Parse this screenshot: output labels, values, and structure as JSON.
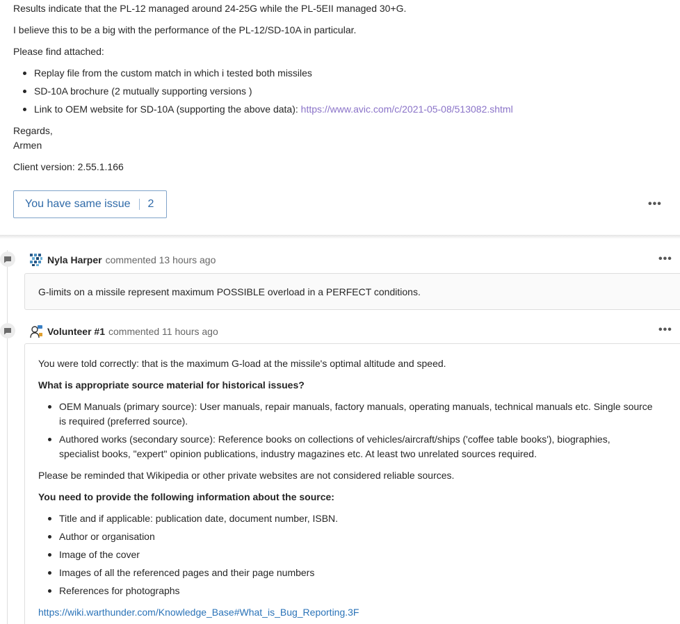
{
  "issue": {
    "line1": "Results indicate that the PL-12 managed around 24-25G while the PL-5EII managed 30+G.",
    "line2": "I believe this to be a big with the performance of the PL-12/SD-10A in particular.",
    "attached_intro": "Please find attached:",
    "attachments": [
      {
        "text": "Replay file from the custom match in which i tested both missiles"
      },
      {
        "text": "SD-10A brochure (2 mutually supporting versions )"
      },
      {
        "text": "Link to OEM website for SD-10A (supporting the above data): ",
        "link": "https://www.avic.com/c/2021-05-08/513082.shtml"
      }
    ],
    "regards": "Regards,",
    "signature": "Armen",
    "client_version": "Client version: 2.55.1.166",
    "same_issue_label": "You have same issue",
    "same_issue_count": "2",
    "more": "•••"
  },
  "comments": [
    {
      "author": "Nyla Harper",
      "meta": "commented 13 hours ago",
      "avatar_icon": "pixel-avatar-icon",
      "more": "•••",
      "text": "G-limits on a missile represent maximum POSSIBLE overload in a PERFECT conditions."
    },
    {
      "author": "Volunteer #1",
      "meta": "commented 11 hours ago",
      "avatar_icon": "volunteer-avatar-icon",
      "more": "•••",
      "intro": "You were told correctly: that is the maximum G-load at the missile's optimal altitude and speed.",
      "heading1": "What is appropriate source material for historical issues?",
      "sources": [
        {
          "line1": "OEM Manuals (primary source): User manuals, repair manuals, factory manuals, operating manuals, technical manuals etc. Single source",
          "line2": "is required (preferred source)."
        },
        {
          "line1": "Authored works (secondary source): Reference books on collections of vehicles/aircraft/ships ('coffee table books'), biographies,",
          "line2": "specialist books, \"expert\" opinion publications, industry magazines etc. At least two unrelated sources required."
        }
      ],
      "reminder": "Please be reminded that Wikipedia or other private websites are not considered reliable sources.",
      "heading2": "You need to provide the following information about the source:",
      "requirements": [
        "Title and if applicable: publication date, document number, ISBN.",
        "Author or organisation",
        "Image of the cover",
        "Images of all the referenced pages and their page numbers",
        "References for photographs"
      ],
      "link": "https://wiki.warthunder.com/Knowledge_Base#What_is_Bug_Reporting.3F"
    }
  ],
  "colors": {
    "accent_button": "#2f6aa8",
    "link_purple": "#8a73c8",
    "link_blue": "#2a73b8"
  }
}
